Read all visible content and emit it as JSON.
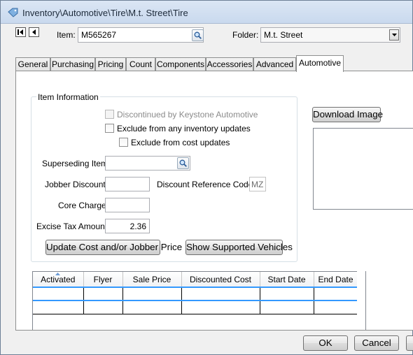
{
  "window": {
    "title": "Inventory\\Automotive\\Tire\\M.t. Street\\Tire",
    "icon": "tag-icon"
  },
  "header": {
    "item_label": "Item:",
    "item_value": "M565267",
    "folder_label": "Folder:",
    "folder_value": "M.t. Street"
  },
  "tabs": [
    {
      "label": "General"
    },
    {
      "label": "Purchasing"
    },
    {
      "label": "Pricing"
    },
    {
      "label": "Count"
    },
    {
      "label": "Components"
    },
    {
      "label": "Accessories"
    },
    {
      "label": "Advanced"
    },
    {
      "label": "Automotive",
      "active": true
    }
  ],
  "item_info": {
    "group_title": "Item Information",
    "discontinued_label": "Discontinued by Keystone Automotive",
    "exclude_inventory_label": "Exclude from any inventory updates",
    "exclude_cost_label": "Exclude from cost updates",
    "superseding_label": "Superseding Item:",
    "superseding_value": "",
    "jobber_discount_label": "Jobber Discount:",
    "jobber_discount_value": "",
    "discount_ref_label": "Discount Reference Code:",
    "discount_ref_value": "MZ",
    "core_charge_label": "Core Charge:",
    "core_charge_value": "",
    "excise_tax_label": "Excise Tax Amount:",
    "excise_tax_value": "2.36",
    "update_cost_button": "Update Cost and/or Jobber Price",
    "show_vehicles_button": "Show Supported Vehicles"
  },
  "image": {
    "download_button": "Download Image"
  },
  "grid": {
    "columns": [
      "Activated",
      "Flyer",
      "Sale Price",
      "Discounted Cost",
      "Start Date",
      "End Date"
    ],
    "rows": [
      [
        "",
        "",
        "",
        "",
        "",
        ""
      ],
      [
        "",
        "",
        "",
        "",
        "",
        ""
      ]
    ]
  },
  "footer": {
    "ok_label": "OK",
    "cancel_label": "Cancel"
  }
}
